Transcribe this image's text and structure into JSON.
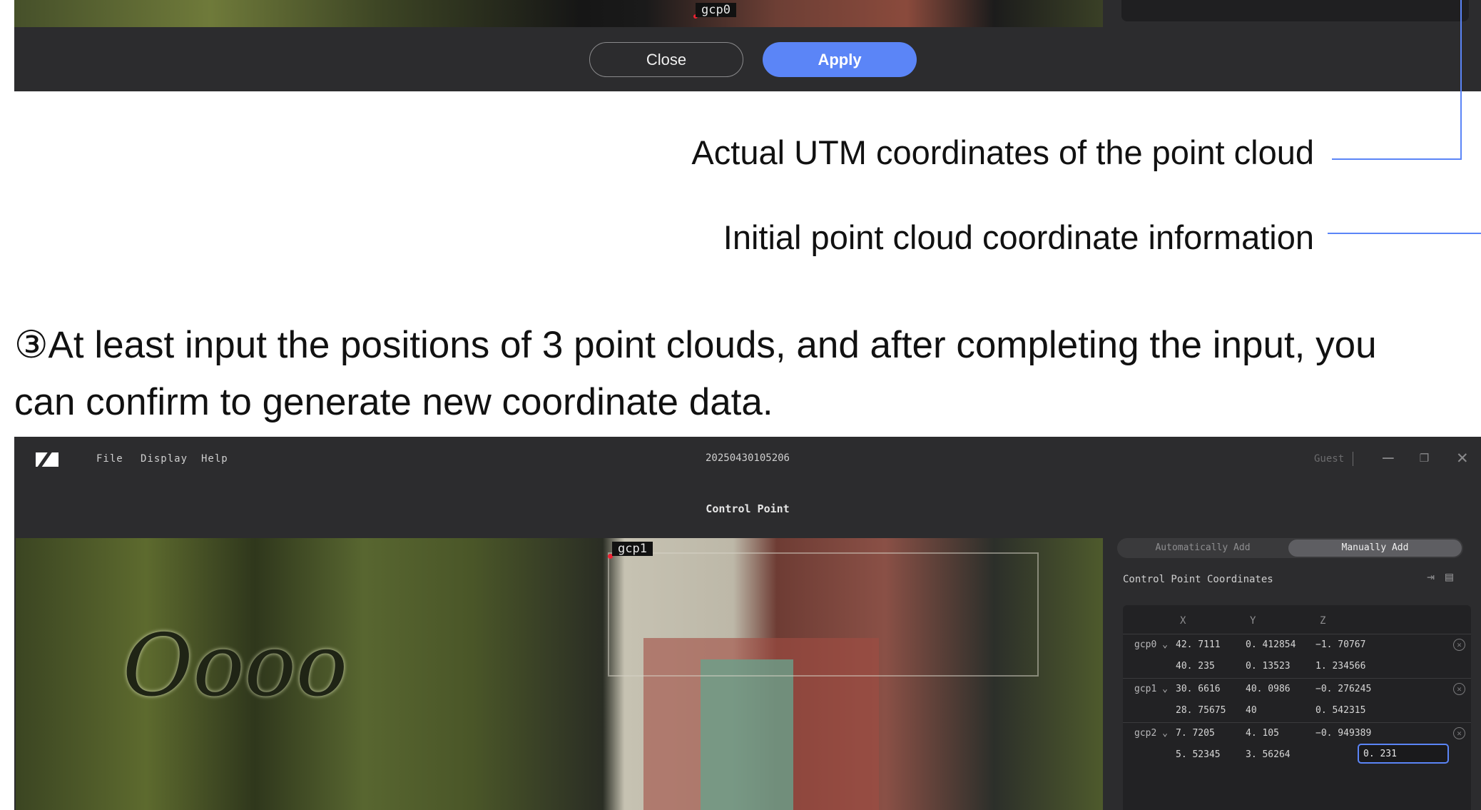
{
  "top_window": {
    "viewport_tag": "gcp0",
    "close_label": "Close",
    "apply_label": "Apply"
  },
  "annotations": {
    "actual_utm": "Actual UTM coordinates of the point cloud",
    "initial_info": "Initial point cloud coordinate information"
  },
  "step": {
    "line1": "③At least input the positions of 3 point clouds, and after completing the input, you",
    "line2": "can confirm to generate new coordinate data."
  },
  "window": {
    "menu": [
      "File",
      "Display",
      "Help"
    ],
    "title": "20250430105206",
    "user": "Guest",
    "panel_title": "Control Point",
    "viewport_tag": "gcp1",
    "tabs": [
      "Automatically Add",
      "Manually Add"
    ],
    "active_tab": "Manually Add",
    "section_title": "Control Point Coordinates",
    "columns": [
      "X",
      "Y",
      "Z"
    ],
    "points": [
      {
        "label": "gcp0",
        "initial": [
          "42. 7111",
          "0. 412854",
          "−1. 70767"
        ],
        "actual": [
          "40. 235",
          "0. 13523",
          "1. 234566"
        ]
      },
      {
        "label": "gcp1",
        "initial": [
          "30. 6616",
          "40. 0986",
          "−0. 276245"
        ],
        "actual": [
          "28. 75675",
          "40",
          "0. 542315"
        ]
      },
      {
        "label": "gcp2",
        "initial": [
          "7. 7205",
          "4. 105",
          "−0. 949389"
        ],
        "actual": [
          "5. 52345",
          "3. 56264",
          "0. 231"
        ]
      }
    ],
    "icons": {
      "export": "export-icon",
      "doc": "document-icon",
      "remove": "remove-circle-icon",
      "expand": "chevron-down-icon"
    },
    "accent_color": "#5b85f7"
  }
}
